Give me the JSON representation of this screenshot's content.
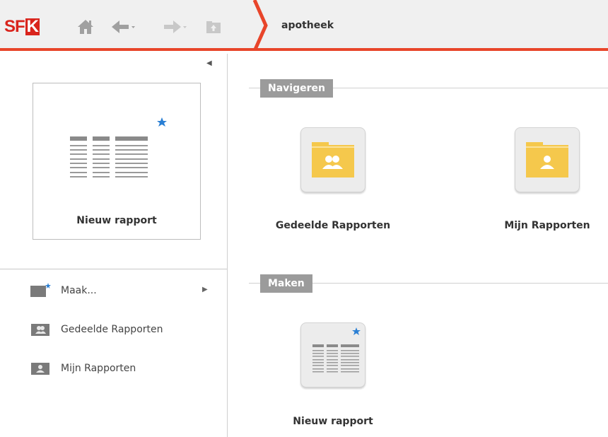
{
  "app": {
    "logo_text": "SF",
    "logo_k": "K"
  },
  "toolbar": {
    "home_icon": "home-icon",
    "back_icon": "back-arrow-icon",
    "forward_icon": "forward-arrow-icon",
    "up_icon": "folder-up-icon"
  },
  "breadcrumb": {
    "current": "apotheek"
  },
  "sidebar": {
    "new_report_card_label": "Nieuw rapport",
    "items": [
      {
        "label": "Maak...",
        "icon": "new-item-icon"
      },
      {
        "label": "Gedeelde Rapporten",
        "icon": "shared-folder-icon"
      },
      {
        "label": "Mijn Rapporten",
        "icon": "user-folder-icon"
      }
    ]
  },
  "main": {
    "sections": [
      {
        "title": "Navigeren",
        "tiles": [
          {
            "label": "Gedeelde Rapporten",
            "icon": "shared-folder-icon"
          },
          {
            "label": "Mijn Rapporten",
            "icon": "user-folder-icon"
          }
        ]
      },
      {
        "title": "Maken",
        "tiles": [
          {
            "label": "Nieuw rapport",
            "icon": "new-report-icon"
          }
        ]
      }
    ]
  },
  "colors": {
    "accent": "#e8452a",
    "logo": "#d9241c",
    "folder": "#f5c84c",
    "star": "#2a7fd4",
    "section_label_bg": "#9b9b9b"
  }
}
